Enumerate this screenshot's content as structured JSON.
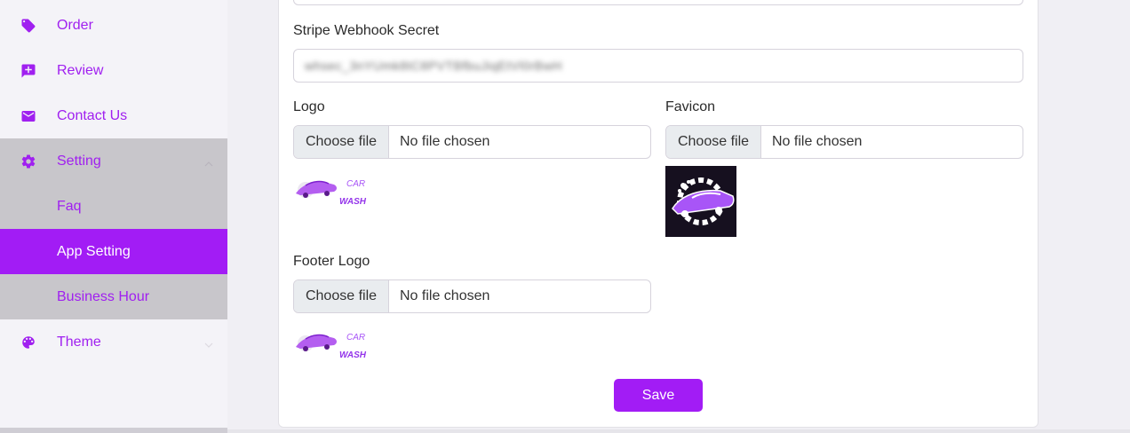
{
  "sidebar": {
    "items": [
      {
        "label": "Order",
        "icon": "tag-icon"
      },
      {
        "label": "Review",
        "icon": "review-icon"
      },
      {
        "label": "Contact Us",
        "icon": "mail-icon"
      },
      {
        "label": "Setting",
        "icon": "gear-icon",
        "expanded": true
      },
      {
        "label": "Faq"
      },
      {
        "label": "App Setting",
        "active": true
      },
      {
        "label": "Business Hour"
      },
      {
        "label": "Theme",
        "icon": "palette-icon"
      }
    ]
  },
  "form": {
    "webhook_label": "Stripe Webhook Secret",
    "webhook_value": "whsec_3nYUmk8tC8PVTBfbuJiqEtVl0rBwH",
    "logo_label": "Logo",
    "favicon_label": "Favicon",
    "footer_logo_label": "Footer Logo",
    "choose_file": "Choose file",
    "no_file": "No file chosen",
    "logo_text_top": "CAR",
    "logo_text_bottom": "WASH",
    "save_label": "Save"
  },
  "colors": {
    "accent": "#a21cf5",
    "sidebar_text": "#a020f0",
    "submenu_bg": "#c8c6cb"
  }
}
